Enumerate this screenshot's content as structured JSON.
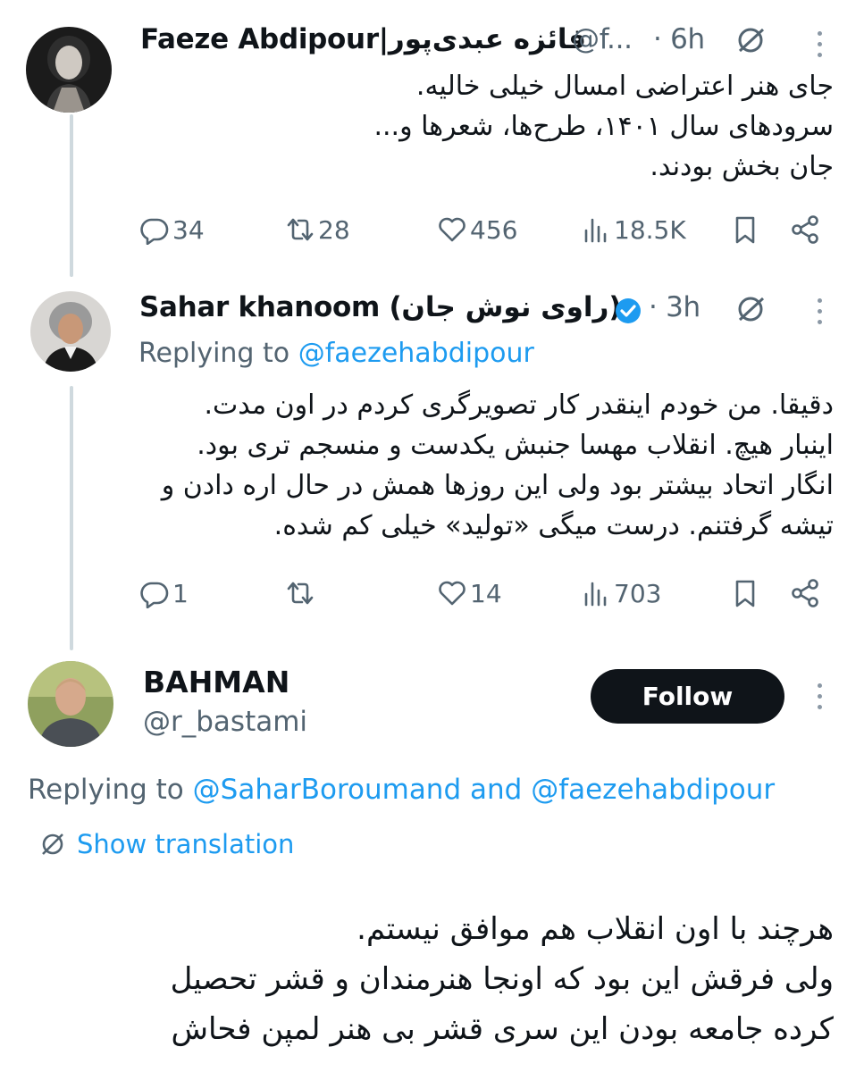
{
  "tweets": [
    {
      "display_name": "Faeze Abdipour|فائزه عبدی‌پور",
      "handle": "@f...",
      "time": "· 6h",
      "lines": [
        "جای هنر اعتراضی امسال خیلی خالیه.",
        "سرودهای سال ۱۴۰۱، طرح‌ها، شعرها و...",
        "جان بخش بودند."
      ],
      "stats": {
        "replies": "34",
        "retweets": "28",
        "likes": "456",
        "views": "18.5K"
      }
    },
    {
      "display_name": "Sahar khanoom (راوی نوش جان)",
      "verified": true,
      "time": "· 3h",
      "replying_label": "Replying to",
      "replying_handle": "@faezehabdipour",
      "lines": [
        "دقیقا. من خودم اینقدر کار تصویرگری کردم در اون مدت.",
        "اینبار هیچ. انقلاب مهسا جنبش یکدست و منسجم تری بود.",
        "انگار اتحاد بیشتر بود ولی این روزها همش در حال اره دادن و",
        "تیشه گرفتنم. درست میگی «تولید» خیلی کم شده."
      ],
      "stats": {
        "replies": "1",
        "retweets": "",
        "likes": "14",
        "views": "703"
      }
    }
  ],
  "main_tweet": {
    "display_name": "BAHMAN",
    "handle": "@r_bastami",
    "follow_label": "Follow",
    "replying_label": "Replying to",
    "replying_handle_1": "@SaharBoroumand",
    "replying_and": "and",
    "replying_handle_2": "@faezehabdipour",
    "translation_label": "Show translation",
    "lines": [
      "هرچند با اون انقلاب هم موافق نیستم.",
      "ولی فرقش این بود که اونجا هنرمندان و قشر تحصیل",
      "کرده جامعه بودن این سری قشر بی هنر لمپن فحاش"
    ]
  },
  "colors": {
    "accent": "#1d9bf0",
    "muted": "#536471",
    "text": "#0f1419",
    "thread_line": "#cfd9de"
  }
}
